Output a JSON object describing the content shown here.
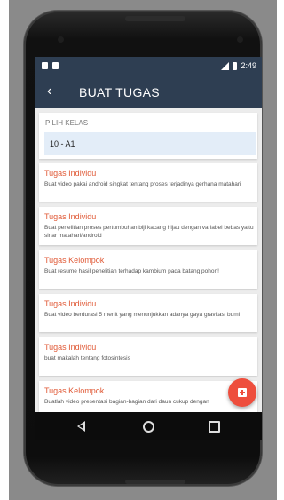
{
  "status_bar": {
    "time": "2:49"
  },
  "app_bar": {
    "title": "BUAT TUGAS"
  },
  "kelas": {
    "label": "PILIH KELAS",
    "value": "10 - A1"
  },
  "tasks": [
    {
      "type": "Tugas Individu",
      "desc": "Buat video pakai android singkat tentang proses terjadinya gerhana matahari"
    },
    {
      "type": "Tugas Individu",
      "desc": "Buat penelitian proses pertumbuhan biji kacang hijau dengan variabel bebas yaitu sinar matahari/android"
    },
    {
      "type": "Tugas Kelompok",
      "desc": "Buat resume hasil penelitian terhadap kambium pada batang pohon!"
    },
    {
      "type": "Tugas Individu",
      "desc": "Buat video berdurasi 5 menit yang menunjukkan adanya gaya gravitasi bumi"
    },
    {
      "type": "Tugas Individu",
      "desc": "buat makalah tentang fotosintesis"
    },
    {
      "type": "Tugas Kelompok",
      "desc": "Buatlah video presentasi bagian-bagian dari daun cukup dengan"
    }
  ],
  "colors": {
    "app_bar": "#2e3e52",
    "accent": "#e05a37",
    "fab": "#ee4e3d"
  },
  "icons": {
    "back": "arrow-back-icon",
    "fab": "add-icon",
    "nav": [
      "nav-back-icon",
      "nav-home-icon",
      "nav-recents-icon"
    ]
  }
}
